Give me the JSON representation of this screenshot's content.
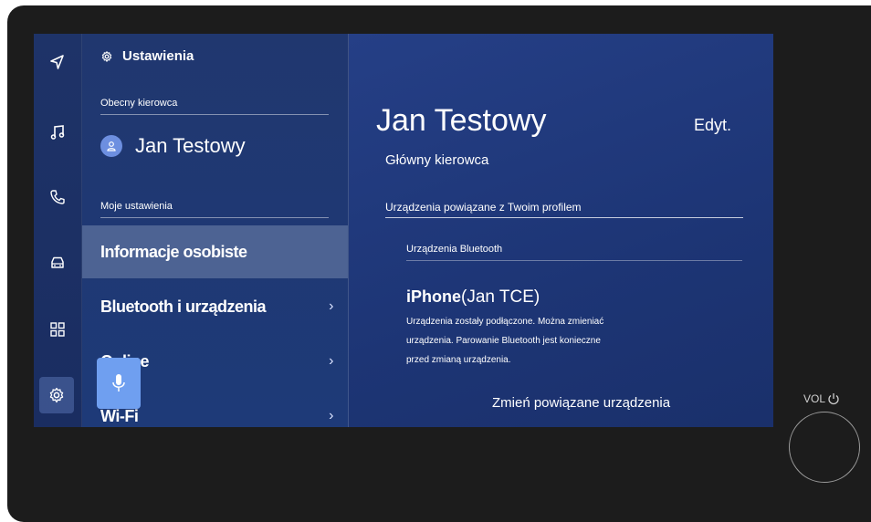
{
  "header": {
    "title": "Ustawienia"
  },
  "current_driver": {
    "section_label": "Obecny kierowca",
    "name": "Jan Testowy"
  },
  "my_settings": {
    "section_label": "Moje ustawienia"
  },
  "menu_items": [
    {
      "label": "Informacje osobiste",
      "active": true
    },
    {
      "label": "Bluetooth i urządzenia",
      "chevron": "›"
    },
    {
      "label": "Online",
      "chevron": "›"
    },
    {
      "label": "Wi-Fi",
      "chevron": "›"
    }
  ],
  "rail_icons": [
    "navigation-icon",
    "music-icon",
    "phone-icon",
    "car-icon",
    "apps-icon",
    "settings-icon"
  ],
  "detail": {
    "name": "Jan Testowy",
    "edit_label": "Edyt.",
    "role": "Główny kierowca",
    "linked_devices_label": "Urządzenia powiązane z Twoim profilem",
    "bluetooth_label": "Urządzenia Bluetooth",
    "device_name": "iPhone",
    "device_owner": "(Jan TCE)",
    "description": "Urządzenia zostały podłączone. Można zmieniać urządzenia. Parowanie Bluetooth jest konieczne przed zmianą urządzenia.",
    "change_button_label": "Zmień powiązane urządzenia"
  },
  "hardware": {
    "volume_label": "VOL"
  }
}
